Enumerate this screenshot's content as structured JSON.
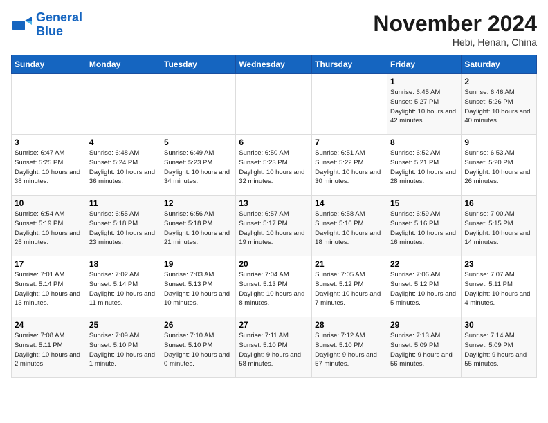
{
  "header": {
    "logo_line1": "General",
    "logo_line2": "Blue",
    "month": "November 2024",
    "location": "Hebi, Henan, China"
  },
  "weekdays": [
    "Sunday",
    "Monday",
    "Tuesday",
    "Wednesday",
    "Thursday",
    "Friday",
    "Saturday"
  ],
  "weeks": [
    [
      {
        "day": "",
        "info": ""
      },
      {
        "day": "",
        "info": ""
      },
      {
        "day": "",
        "info": ""
      },
      {
        "day": "",
        "info": ""
      },
      {
        "day": "",
        "info": ""
      },
      {
        "day": "1",
        "info": "Sunrise: 6:45 AM\nSunset: 5:27 PM\nDaylight: 10 hours\nand 42 minutes."
      },
      {
        "day": "2",
        "info": "Sunrise: 6:46 AM\nSunset: 5:26 PM\nDaylight: 10 hours\nand 40 minutes."
      }
    ],
    [
      {
        "day": "3",
        "info": "Sunrise: 6:47 AM\nSunset: 5:25 PM\nDaylight: 10 hours\nand 38 minutes."
      },
      {
        "day": "4",
        "info": "Sunrise: 6:48 AM\nSunset: 5:24 PM\nDaylight: 10 hours\nand 36 minutes."
      },
      {
        "day": "5",
        "info": "Sunrise: 6:49 AM\nSunset: 5:23 PM\nDaylight: 10 hours\nand 34 minutes."
      },
      {
        "day": "6",
        "info": "Sunrise: 6:50 AM\nSunset: 5:23 PM\nDaylight: 10 hours\nand 32 minutes."
      },
      {
        "day": "7",
        "info": "Sunrise: 6:51 AM\nSunset: 5:22 PM\nDaylight: 10 hours\nand 30 minutes."
      },
      {
        "day": "8",
        "info": "Sunrise: 6:52 AM\nSunset: 5:21 PM\nDaylight: 10 hours\nand 28 minutes."
      },
      {
        "day": "9",
        "info": "Sunrise: 6:53 AM\nSunset: 5:20 PM\nDaylight: 10 hours\nand 26 minutes."
      }
    ],
    [
      {
        "day": "10",
        "info": "Sunrise: 6:54 AM\nSunset: 5:19 PM\nDaylight: 10 hours\nand 25 minutes."
      },
      {
        "day": "11",
        "info": "Sunrise: 6:55 AM\nSunset: 5:18 PM\nDaylight: 10 hours\nand 23 minutes."
      },
      {
        "day": "12",
        "info": "Sunrise: 6:56 AM\nSunset: 5:18 PM\nDaylight: 10 hours\nand 21 minutes."
      },
      {
        "day": "13",
        "info": "Sunrise: 6:57 AM\nSunset: 5:17 PM\nDaylight: 10 hours\nand 19 minutes."
      },
      {
        "day": "14",
        "info": "Sunrise: 6:58 AM\nSunset: 5:16 PM\nDaylight: 10 hours\nand 18 minutes."
      },
      {
        "day": "15",
        "info": "Sunrise: 6:59 AM\nSunset: 5:16 PM\nDaylight: 10 hours\nand 16 minutes."
      },
      {
        "day": "16",
        "info": "Sunrise: 7:00 AM\nSunset: 5:15 PM\nDaylight: 10 hours\nand 14 minutes."
      }
    ],
    [
      {
        "day": "17",
        "info": "Sunrise: 7:01 AM\nSunset: 5:14 PM\nDaylight: 10 hours\nand 13 minutes."
      },
      {
        "day": "18",
        "info": "Sunrise: 7:02 AM\nSunset: 5:14 PM\nDaylight: 10 hours\nand 11 minutes."
      },
      {
        "day": "19",
        "info": "Sunrise: 7:03 AM\nSunset: 5:13 PM\nDaylight: 10 hours\nand 10 minutes."
      },
      {
        "day": "20",
        "info": "Sunrise: 7:04 AM\nSunset: 5:13 PM\nDaylight: 10 hours\nand 8 minutes."
      },
      {
        "day": "21",
        "info": "Sunrise: 7:05 AM\nSunset: 5:12 PM\nDaylight: 10 hours\nand 7 minutes."
      },
      {
        "day": "22",
        "info": "Sunrise: 7:06 AM\nSunset: 5:12 PM\nDaylight: 10 hours\nand 5 minutes."
      },
      {
        "day": "23",
        "info": "Sunrise: 7:07 AM\nSunset: 5:11 PM\nDaylight: 10 hours\nand 4 minutes."
      }
    ],
    [
      {
        "day": "24",
        "info": "Sunrise: 7:08 AM\nSunset: 5:11 PM\nDaylight: 10 hours\nand 2 minutes."
      },
      {
        "day": "25",
        "info": "Sunrise: 7:09 AM\nSunset: 5:10 PM\nDaylight: 10 hours\nand 1 minute."
      },
      {
        "day": "26",
        "info": "Sunrise: 7:10 AM\nSunset: 5:10 PM\nDaylight: 10 hours\nand 0 minutes."
      },
      {
        "day": "27",
        "info": "Sunrise: 7:11 AM\nSunset: 5:10 PM\nDaylight: 9 hours\nand 58 minutes."
      },
      {
        "day": "28",
        "info": "Sunrise: 7:12 AM\nSunset: 5:10 PM\nDaylight: 9 hours\nand 57 minutes."
      },
      {
        "day": "29",
        "info": "Sunrise: 7:13 AM\nSunset: 5:09 PM\nDaylight: 9 hours\nand 56 minutes."
      },
      {
        "day": "30",
        "info": "Sunrise: 7:14 AM\nSunset: 5:09 PM\nDaylight: 9 hours\nand 55 minutes."
      }
    ]
  ]
}
